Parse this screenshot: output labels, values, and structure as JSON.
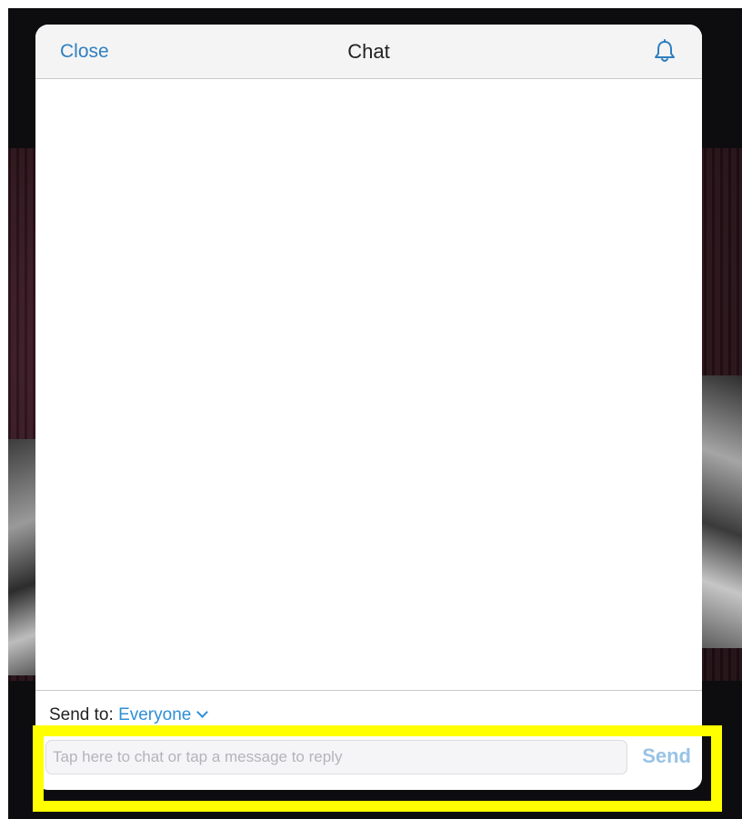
{
  "header": {
    "close_label": "Close",
    "title": "Chat",
    "bell_icon": "bell-icon"
  },
  "send_to": {
    "label": "Send to:",
    "value": "Everyone",
    "chevron_icon": "chevron-down-icon"
  },
  "input": {
    "placeholder": "Tap here to chat or tap a message to reply",
    "value": ""
  },
  "send_label": "Send",
  "colors": {
    "accent": "#2f7fc0",
    "send_disabled": "#98c3e6",
    "highlight": "#ffff00",
    "backdrop": "#0d0d0f"
  }
}
